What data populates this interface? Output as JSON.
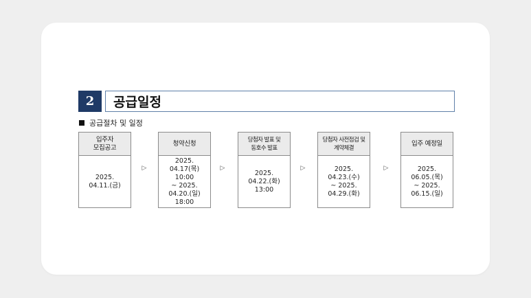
{
  "section": {
    "number": "2",
    "title": "공급일정",
    "subtitle": "공급절차 및 일정"
  },
  "steps": [
    {
      "label": "입주자\n모집공고",
      "date": "2025.\n04.11.(금)"
    },
    {
      "label": "청약신청",
      "date": "2025.\n04.17(목)\n10:00\n~ 2025.\n04.20.(일)\n18:00"
    },
    {
      "label": "당첨자 발표 및\n동호수 발표",
      "date": "2025.\n04.22.(화)\n13:00"
    },
    {
      "label": "당첨자 사전점검 및\n계약체결",
      "date": "2025.\n04.23.(수)\n~ 2025.\n04.29.(화)"
    },
    {
      "label": "입주 예정일",
      "date": "2025.\n06.05.(목)\n~ 2025.\n06.15.(일)"
    }
  ],
  "arrow_glyph": "▷"
}
